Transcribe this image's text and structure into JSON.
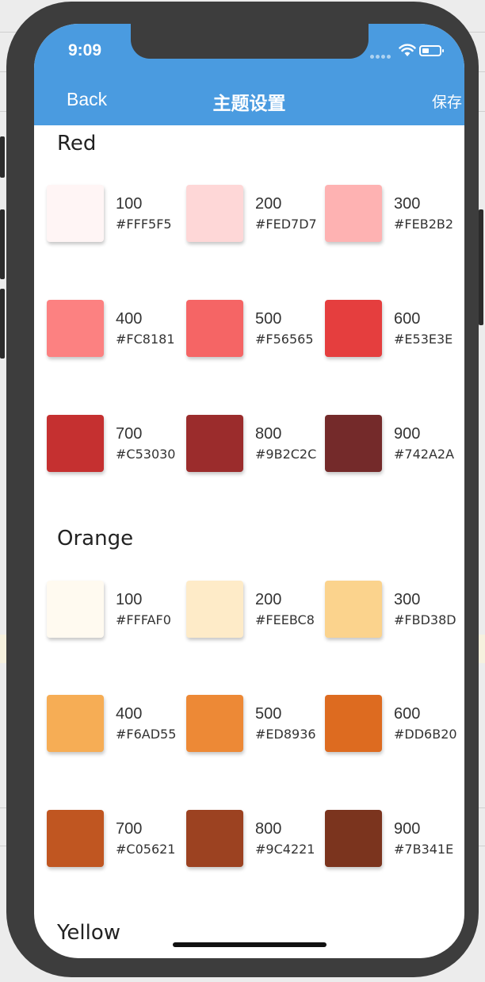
{
  "status_bar": {
    "time": "9:09"
  },
  "nav": {
    "back_label": "Back",
    "title": "主题设置",
    "save_label": "保存"
  },
  "sections": [
    {
      "title": "Red",
      "swatches": [
        {
          "shade": "100",
          "hex": "#FFF5F5",
          "color": "#FFF5F5"
        },
        {
          "shade": "200",
          "hex": "#FED7D7",
          "color": "#FED7D7"
        },
        {
          "shade": "300",
          "hex": "#FEB2B2",
          "color": "#FEB2B2"
        },
        {
          "shade": "400",
          "hex": "#FC8181",
          "color": "#FC8181"
        },
        {
          "shade": "500",
          "hex": "#F56565",
          "color": "#F56565"
        },
        {
          "shade": "600",
          "hex": "#E53E3E",
          "color": "#E53E3E"
        },
        {
          "shade": "700",
          "hex": "#C53030",
          "color": "#C53030"
        },
        {
          "shade": "800",
          "hex": "#9B2C2C",
          "color": "#9B2C2C"
        },
        {
          "shade": "900",
          "hex": "#742A2A",
          "color": "#742A2A"
        }
      ]
    },
    {
      "title": "Orange",
      "swatches": [
        {
          "shade": "100",
          "hex": "#FFFAF0",
          "color": "#FFFAF0"
        },
        {
          "shade": "200",
          "hex": "#FEEBC8",
          "color": "#FEEBC8"
        },
        {
          "shade": "300",
          "hex": "#FBD38D",
          "color": "#FBD38D"
        },
        {
          "shade": "400",
          "hex": "#F6AD55",
          "color": "#F6AD55"
        },
        {
          "shade": "500",
          "hex": "#ED8936",
          "color": "#ED8936"
        },
        {
          "shade": "600",
          "hex": "#DD6B20",
          "color": "#DD6B20"
        },
        {
          "shade": "700",
          "hex": "#C05621",
          "color": "#C05621"
        },
        {
          "shade": "800",
          "hex": "#9C4221",
          "color": "#9C4221"
        },
        {
          "shade": "900",
          "hex": "#7B341E",
          "color": "#7B341E"
        }
      ]
    },
    {
      "title": "Yellow",
      "swatches": []
    }
  ]
}
